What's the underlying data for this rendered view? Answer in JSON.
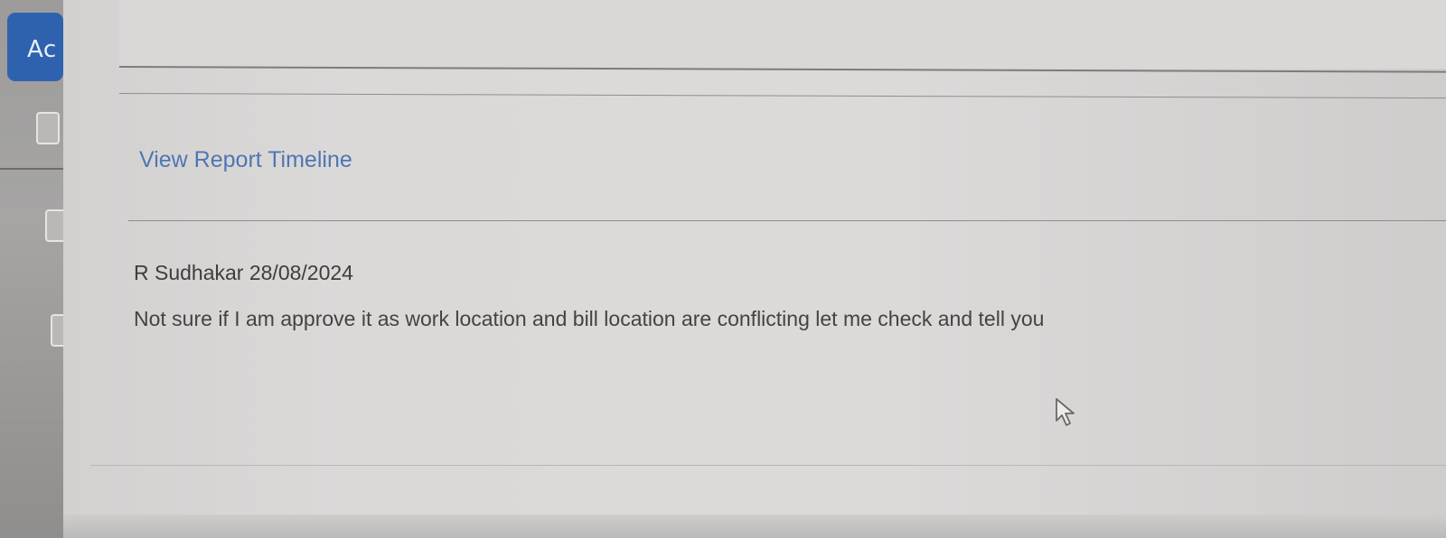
{
  "left_rail": {
    "action_button_label": "Ac",
    "checkbox_count": 3
  },
  "report": {
    "timeline_link": "View Report Timeline"
  },
  "comment": {
    "author_date": "R Sudhakar 28/08/2024",
    "text": "Not sure if I am approve it as work location and bill location are conflicting let me check and tell you"
  },
  "colors": {
    "accent": "#2f62ae",
    "link": "#4f76b4"
  },
  "icons": {
    "cursor": "mouse-pointer-icon"
  }
}
